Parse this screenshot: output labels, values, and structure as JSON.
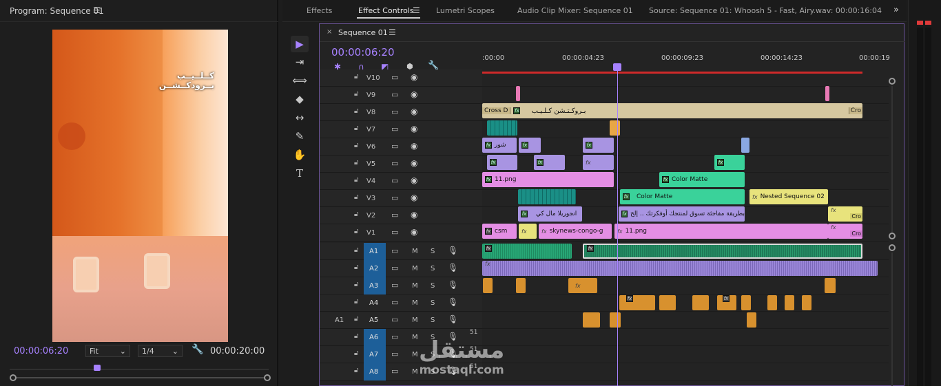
{
  "program": {
    "title": "Program: Sequence 01",
    "overlay_text_line1": "كــلــيــب",
    "overlay_text_line2": "بــرودكــشــن",
    "timecode_current": "00:00:06:20",
    "fit": "Fit",
    "resolution": "1/4",
    "timecode_duration": "00:00:20:00"
  },
  "tabs": [
    "Effects",
    "Effect Controls",
    "Lumetri Scopes",
    "Audio Clip Mixer: Sequence 01",
    "Source: Sequence 01: Whoosh 5 - Fast, Airy.wav: 00:00:16:04"
  ],
  "sequence": {
    "tab_label": "Sequence 01",
    "timecode": "00:00:06:20",
    "ruler": [
      ":00:00",
      "00:00:04:23",
      "00:00:09:23",
      "00:00:14:23",
      "00:00:19"
    ],
    "video_tracks": [
      "V10",
      "V9",
      "V8",
      "V7",
      "V6",
      "V5",
      "V4",
      "V3",
      "V2",
      "V1"
    ],
    "audio_tracks": [
      "A1",
      "A2",
      "A3",
      "A4",
      "A5",
      "A6",
      "A7",
      "A8"
    ],
    "source_patch_a5": "A1",
    "mute_label": "M",
    "solo_label": "S",
    "clip_labels": {
      "cross_d": "Cross D",
      "v8_title": "بـروكـتـشن كـلـيـب",
      "v8_end": "Cro",
      "v6_title": "شور",
      "v4_png": "11.png",
      "v4_color": "Color Matte",
      "v3_color": "Color Matte",
      "v3_nested": "Nested Sequence 02",
      "v3_end": "Cro",
      "v2_a": "انجوريلا مال كي",
      "v2_b": "بطريقة مفاجئة تسوق لمنتجك أوفكرتك .. إلخ",
      "v2_end": "Cro",
      "v1_csm": "csm",
      "v1_sky": "skynews-congo-g",
      "v1_png": "11.png",
      "v1_end": "Cro"
    },
    "level_51": "51"
  },
  "watermark": {
    "text_ar": "مستقل",
    "text_en": "mostaql.com"
  },
  "colors": {
    "accent": "#a782ff",
    "title_clip": "#d6c8a0",
    "pink_clip": "#e48ee4",
    "lavender_clip": "#a894e2",
    "green_clip": "#3ad29a",
    "yellow_clip": "#e8e37c",
    "teal_clip": "#1a8f86",
    "audio_green": "#27a776",
    "audio_lavender": "#9a86d8",
    "audio_orange": "#d8912e"
  }
}
